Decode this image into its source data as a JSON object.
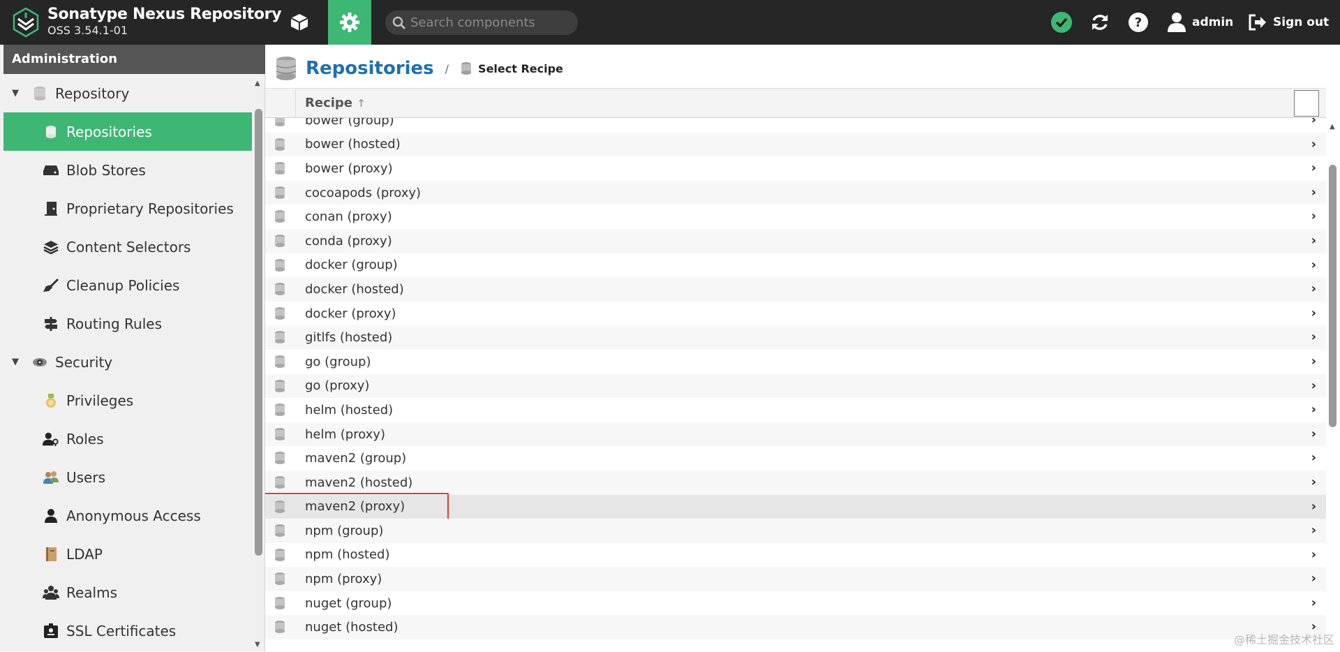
{
  "header": {
    "title": "Sonatype Nexus Repository",
    "version": "OSS 3.54.1-01",
    "search_placeholder": "Search components",
    "user": "admin",
    "signout": "Sign out"
  },
  "colors": {
    "accent": "#3eb775",
    "header_bg": "#262626",
    "link": "#1e6fb0",
    "highlight": "#e53935"
  },
  "sidebar": {
    "header": "Administration",
    "groups": [
      {
        "label": "Repository",
        "icon": "database-icon",
        "items": [
          {
            "label": "Repositories",
            "icon": "database-icon",
            "active": true
          },
          {
            "label": "Blob Stores",
            "icon": "hdd-icon"
          },
          {
            "label": "Proprietary Repositories",
            "icon": "door-icon"
          },
          {
            "label": "Content Selectors",
            "icon": "layers-icon"
          },
          {
            "label": "Cleanup Policies",
            "icon": "broom-icon"
          },
          {
            "label": "Routing Rules",
            "icon": "signpost-icon"
          }
        ]
      },
      {
        "label": "Security",
        "icon": "eye-icon",
        "items": [
          {
            "label": "Privileges",
            "icon": "medal-icon"
          },
          {
            "label": "Roles",
            "icon": "user-key-icon"
          },
          {
            "label": "Users",
            "icon": "users-icon"
          },
          {
            "label": "Anonymous Access",
            "icon": "user-icon"
          },
          {
            "label": "LDAP",
            "icon": "book-icon"
          },
          {
            "label": "Realms",
            "icon": "realms-icon"
          },
          {
            "label": "SSL Certificates",
            "icon": "certificate-icon"
          }
        ]
      }
    ]
  },
  "main": {
    "breadcrumb_title": "Repositories",
    "breadcrumb_sep": "/",
    "breadcrumb_sub": "Select Recipe",
    "column_header": "Recipe",
    "sort_icon": "↑",
    "rows": [
      "bower (group)",
      "bower (hosted)",
      "bower (proxy)",
      "cocoapods (proxy)",
      "conan (proxy)",
      "conda (proxy)",
      "docker (group)",
      "docker (hosted)",
      "docker (proxy)",
      "gitlfs (hosted)",
      "go (group)",
      "go (proxy)",
      "helm (hosted)",
      "helm (proxy)",
      "maven2 (group)",
      "maven2 (hosted)",
      "maven2 (proxy)",
      "npm (group)",
      "npm (hosted)",
      "npm (proxy)",
      "nuget (group)",
      "nuget (hosted)"
    ],
    "selected_row": "maven2 (proxy)"
  },
  "watermark": "@稀土掘金技术社区"
}
